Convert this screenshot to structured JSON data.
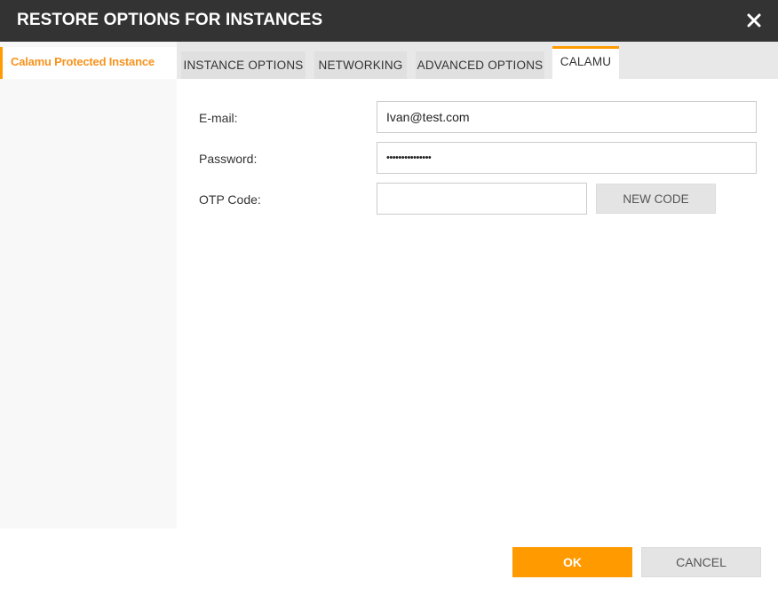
{
  "dialog": {
    "title": "RESTORE OPTIONS FOR INSTANCES",
    "close_icon": "close-icon"
  },
  "sidebar": {
    "items": [
      {
        "label": "Calamu Protected Instance",
        "active": true
      }
    ]
  },
  "tabs": [
    {
      "label": "INSTANCE OPTIONS",
      "active": false
    },
    {
      "label": "NETWORKING",
      "active": false
    },
    {
      "label": "ADVANCED OPTIONS",
      "active": false
    },
    {
      "label": "CALAMU",
      "active": true
    }
  ],
  "form": {
    "email": {
      "label": "E-mail:",
      "value": "Ivan@test.com"
    },
    "password": {
      "label": "Password:",
      "value": "•••••••••••••••"
    },
    "otp": {
      "label": "OTP Code:",
      "value": ""
    },
    "new_code_label": "NEW CODE"
  },
  "footer": {
    "ok_label": "OK",
    "cancel_label": "CANCEL"
  },
  "colors": {
    "accent": "#ff9a00",
    "titlebar": "#333333",
    "sidebar_active_text": "#f7931e"
  }
}
